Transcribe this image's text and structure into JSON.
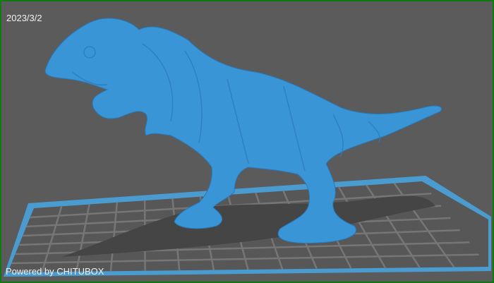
{
  "viewport": {
    "date_label": "2023/3/2",
    "watermark": "Powered by CHITUBOX",
    "colors": {
      "model": "#3a95d6",
      "platform_edge": "#4a9cd0",
      "grid": "#7a7a7a",
      "background": "#5b5b5b",
      "border": "#0f7a0f"
    }
  }
}
